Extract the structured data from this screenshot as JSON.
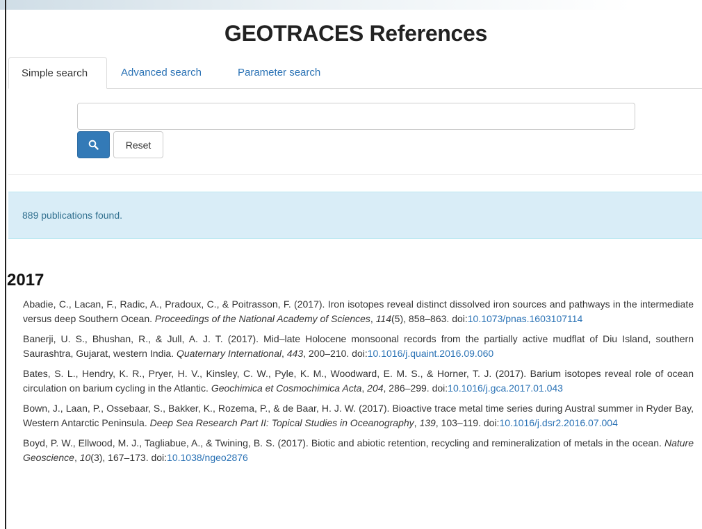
{
  "page": {
    "title": "GEOTRACES References"
  },
  "tabs": [
    {
      "label": "Simple search",
      "active": true
    },
    {
      "label": "Advanced search",
      "active": false
    },
    {
      "label": "Parameter search",
      "active": false
    }
  ],
  "search": {
    "value": "",
    "placeholder": "",
    "submit_icon": "search-icon",
    "reset_label": "Reset"
  },
  "results": {
    "count_text": "889 publications found."
  },
  "year_group": {
    "year": "2017"
  },
  "references": [
    {
      "authors": "Abadie, C., Lacan, F., Radic, A., Pradoux, C., & Poitrasson, F. (2017). Iron isotopes reveal distinct dissolved iron sources and pathways in the intermediate versus deep Southern Ocean. ",
      "journal": "Proceedings of the National Academy of Sciences",
      "volume_sep": ", ",
      "volume": "114",
      "pages": "(5), 858–863. doi:",
      "doi": "10.1073/pnas.1603107114"
    },
    {
      "authors": "Banerji, U. S., Bhushan, R., & Jull, A. J. T. (2017). Mid–late Holocene monsoonal records from the partially active mudflat of Diu Island, southern Saurashtra, Gujarat, western India. ",
      "journal": "Quaternary International",
      "volume_sep": ", ",
      "volume": "443",
      "pages": ", 200–210. doi:",
      "doi": "10.1016/j.quaint.2016.09.060"
    },
    {
      "authors": "Bates, S. L., Hendry, K. R., Pryer, H. V., Kinsley, C. W., Pyle, K. M., Woodward, E. M. S., & Horner, T. J. (2017). Barium isotopes reveal role of ocean circulation on barium cycling in the Atlantic. ",
      "journal": "Geochimica et Cosmochimica Acta",
      "volume_sep": ", ",
      "volume": "204",
      "pages": ", 286–299. doi:",
      "doi": "10.1016/j.gca.2017.01.043"
    },
    {
      "authors": "Bown, J., Laan, P., Ossebaar, S., Bakker, K., Rozema, P., & de Baar, H. J. W. (2017). Bioactive trace metal time series during Austral summer in Ryder Bay, Western Antarctic Peninsula. ",
      "journal": "Deep Sea Research Part II: Topical Studies in Oceanography",
      "volume_sep": ", ",
      "volume": "139",
      "pages": ", 103–119. doi:",
      "doi": "10.1016/j.dsr2.2016.07.004"
    },
    {
      "authors": "Boyd, P. W., Ellwood, M. J., Tagliabue, A., & Twining, B. S. (2017). Biotic and abiotic retention, recycling and remineralization of metals in the ocean. ",
      "journal": "Nature Geoscience",
      "volume_sep": ", ",
      "volume": "10",
      "pages": "(3), 167–173. doi:",
      "doi": "10.1038/ngeo2876"
    }
  ],
  "colors": {
    "link": "#2a72b5",
    "primary_button": "#337ab7",
    "alert_bg": "#d9edf7",
    "alert_text": "#31708f"
  }
}
